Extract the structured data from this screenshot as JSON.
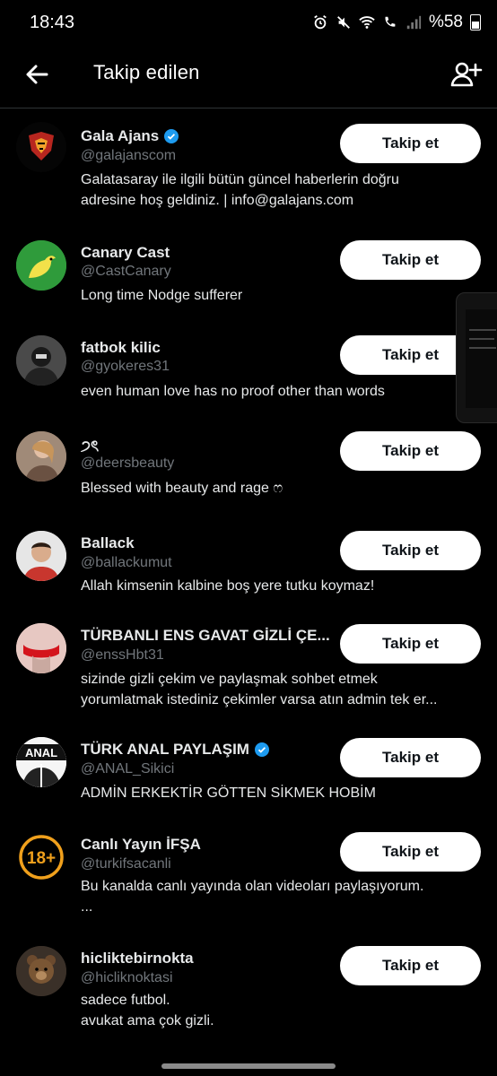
{
  "status_bar": {
    "time": "18:43",
    "battery": "%58"
  },
  "header": {
    "title": "Takip edilen"
  },
  "colors": {
    "background": "#000000",
    "text": "#e7e9ea",
    "secondary": "#71767b",
    "verified": "#1d9bf0",
    "button_bg": "#ffffff"
  },
  "users": [
    {
      "name": "Gala Ajans",
      "verified": true,
      "handle": "@galajanscom",
      "bio": [
        "Galatasaray ile ilgili bütün güncel haberlerin doğru",
        "adresine hoş geldiniz. | info@galajans.com"
      ],
      "button": "Takip et",
      "avatar_icon": "lion-logo-icon"
    },
    {
      "name": "Canary Cast",
      "verified": false,
      "handle": "@CastCanary",
      "bio": [
        "Long time Nodge sufferer"
      ],
      "button": "Takip et",
      "avatar_icon": "canary-bird-icon"
    },
    {
      "name": "fatbok kilic",
      "verified": false,
      "handle": "@gyokeres31",
      "bio": [
        "even human love has no proof other than words"
      ],
      "button": "Takip et",
      "avatar_icon": "person-photo-icon"
    },
    {
      "name": "੭ৎ",
      "verified": false,
      "handle": "@deersbeauty",
      "bio": [
        "Blessed with beauty and rage ෆ"
      ],
      "button": "Takip et",
      "avatar_icon": "person-photo-icon"
    },
    {
      "name": "Ballack",
      "verified": false,
      "handle": "@ballackumut",
      "bio": [
        "Allah kimsenin kalbine boş yere tutku koymaz!"
      ],
      "button": "Takip et",
      "avatar_icon": "person-photo-icon"
    },
    {
      "name": "TÜRBANLI ENS GAVAT GİZLİ ÇE...",
      "verified": false,
      "handle": "@enssHbt31",
      "bio": [
        "sizinde gizli çekim ve paylaşmak sohbet etmek",
        "yorumlatmak istediniz çekimler varsa atın admin tek er..."
      ],
      "button": "Takip et",
      "avatar_icon": "person-photo-icon"
    },
    {
      "name": "TÜRK ANAL PAYLAŞIM",
      "verified": true,
      "handle": "@ANAL_Sikici",
      "bio": [
        "ADMİN ERKEKTİR GÖTTEN  SİKMEK HOBİM"
      ],
      "button": "Takip et",
      "avatar_icon": "text-logo-icon",
      "avatar_text": "ANAL"
    },
    {
      "name": "Canlı Yayın İFŞA",
      "verified": false,
      "handle": "@turkifsacanli",
      "bio": [
        "Bu kanalda canlı yayında olan videoları paylaşıyorum.",
        "..."
      ],
      "button": "Takip et",
      "avatar_icon": "age-18-plus-icon",
      "avatar_text": "18+"
    },
    {
      "name": "hicliktebirnokta",
      "verified": false,
      "handle": "@hicliknoktasi",
      "bio": [
        "sadece futbol.",
        "avukat ama çok gizli."
      ],
      "button": "Takip et",
      "avatar_icon": "bear-photo-icon"
    }
  ]
}
